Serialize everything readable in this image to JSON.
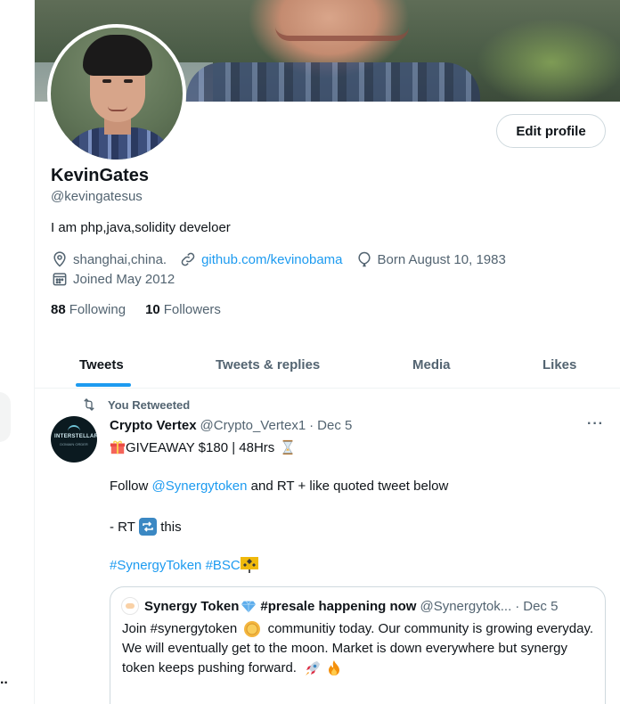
{
  "profile": {
    "display_name": "KevinGates",
    "handle": "@kevingatesus",
    "bio": "I am php,java,solidity develoer",
    "location": "shanghai,china.",
    "website": "github.com/kevinobama",
    "birthday": "Born August 10, 1983",
    "joined": "Joined May 2012",
    "following_count": "88",
    "following_label": "Following",
    "followers_count": "10",
    "followers_label": "Followers",
    "edit_button": "Edit profile"
  },
  "tabs": [
    {
      "label": "Tweets",
      "active": true
    },
    {
      "label": "Tweets & replies",
      "active": false
    },
    {
      "label": "Media",
      "active": false
    },
    {
      "label": "Likes",
      "active": false
    }
  ],
  "tweet": {
    "retweet_label": "You Retweeted",
    "author": "Crypto Vertex",
    "handle": "@Crypto_Vertex1",
    "separator": "·",
    "date": "Dec 5",
    "avatar_logo_text": "INTERSTELLAR",
    "avatar_logo_sub": "DOMAIN ORDER",
    "line1": "GIVEAWAY $180 | 48Hrs",
    "line2_prefix": "Follow",
    "line2_mention": "@Synergytoken",
    "line2_suffix": "and RT + like quoted tweet below",
    "line3_prefix": "- RT",
    "line3_suffix": "this",
    "hashtag1": "#SynergyToken",
    "hashtag2": "#BSC",
    "more_label": "···"
  },
  "quote": {
    "author": "Synergy Token",
    "author_suffix": "#presale happening now",
    "handle": "@Synergytok...",
    "separator": "·",
    "date": "Dec 5",
    "text_part1": "Join #synergytoken",
    "text_part2": "communitiy today. Our community is growing everyday. We will eventually get to the moon. Market is down everywhere but synergy token keeps pushing forward."
  },
  "colors": {
    "accent": "#1d9bf0",
    "text": "#0f1419",
    "muted": "#536471",
    "border": "#cfd9de"
  }
}
